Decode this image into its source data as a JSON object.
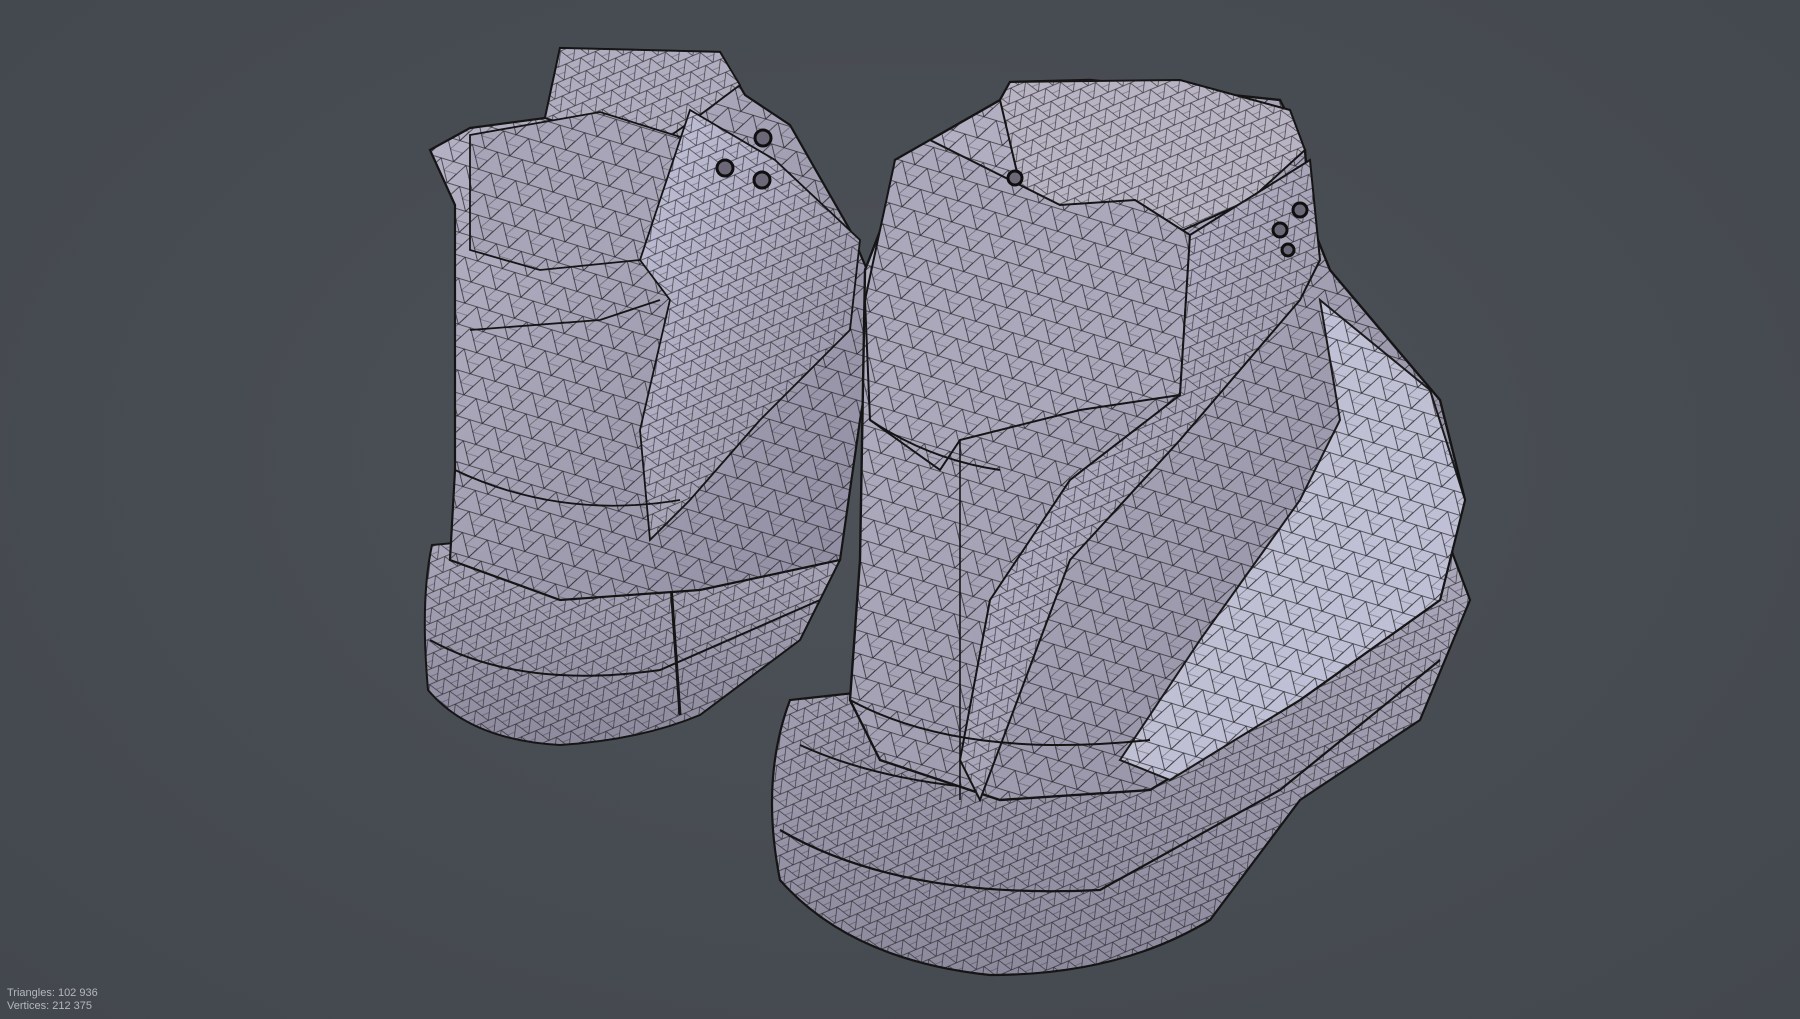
{
  "viewport": {
    "background_color": "#474c52",
    "mesh_base_color": "#a6a2b6",
    "mesh_highlight_color": "#c9cbe2",
    "wireframe_color": "#151515"
  },
  "model": {
    "subject": "pair of high-top sneakers",
    "display_mode": "shaded wireframe"
  },
  "stats": {
    "triangles": "Triangles: 102 936",
    "vertices": "Vertices: 212 375"
  }
}
